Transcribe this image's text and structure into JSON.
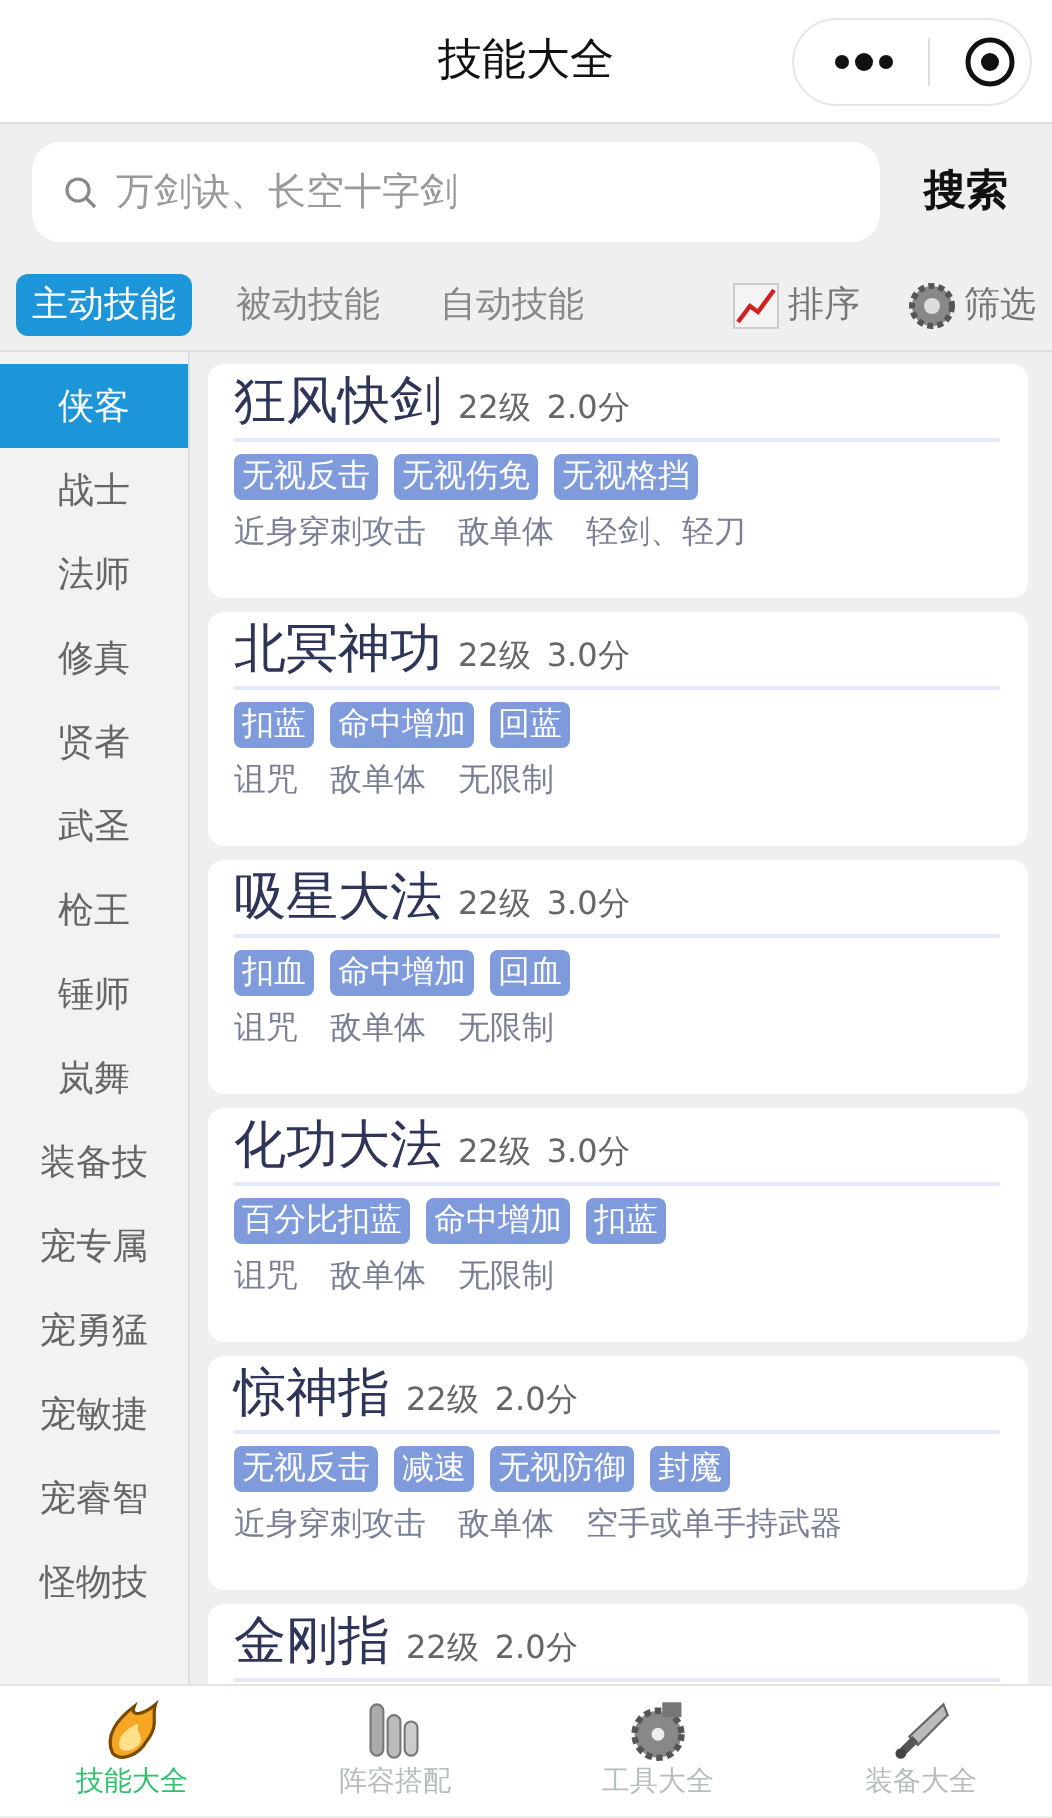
{
  "header": {
    "title": "技能大全"
  },
  "search": {
    "placeholder": "万剑诀、长空十字剑",
    "button": "搜索"
  },
  "tabs": [
    {
      "label": "主动技能",
      "selected": true
    },
    {
      "label": "被动技能",
      "selected": false
    },
    {
      "label": "自动技能",
      "selected": false
    }
  ],
  "tools": [
    {
      "label": "排序",
      "kind": "sort"
    },
    {
      "label": "筛选",
      "kind": "filter"
    }
  ],
  "sidebar": {
    "items": [
      {
        "label": "侠客",
        "selected": true
      },
      {
        "label": "战士",
        "selected": false
      },
      {
        "label": "法师",
        "selected": false
      },
      {
        "label": "修真",
        "selected": false
      },
      {
        "label": "贤者",
        "selected": false
      },
      {
        "label": "武圣",
        "selected": false
      },
      {
        "label": "枪王",
        "selected": false
      },
      {
        "label": "锤师",
        "selected": false
      },
      {
        "label": "岚舞",
        "selected": false
      },
      {
        "label": "装备技",
        "selected": false
      },
      {
        "label": "宠专属",
        "selected": false
      },
      {
        "label": "宠勇猛",
        "selected": false
      },
      {
        "label": "宠敏捷",
        "selected": false
      },
      {
        "label": "宠睿智",
        "selected": false
      },
      {
        "label": "怪物技",
        "selected": false
      }
    ]
  },
  "skills": [
    {
      "name": "狂风快剑",
      "level": "22级",
      "score": "2.0分",
      "tags": [
        "无视反击",
        "无视伤免",
        "无视格挡"
      ],
      "props": [
        "近身穿刺攻击",
        "敌单体",
        "轻剑、轻刀"
      ]
    },
    {
      "name": "北冥神功",
      "level": "22级",
      "score": "3.0分",
      "tags": [
        "扣蓝",
        "命中增加",
        "回蓝"
      ],
      "props": [
        "诅咒",
        "敌单体",
        "无限制"
      ]
    },
    {
      "name": "吸星大法",
      "level": "22级",
      "score": "3.0分",
      "tags": [
        "扣血",
        "命中增加",
        "回血"
      ],
      "props": [
        "诅咒",
        "敌单体",
        "无限制"
      ]
    },
    {
      "name": "化功大法",
      "level": "22级",
      "score": "3.0分",
      "tags": [
        "百分比扣蓝",
        "命中增加",
        "扣蓝"
      ],
      "props": [
        "诅咒",
        "敌单体",
        "无限制"
      ]
    },
    {
      "name": "惊神指",
      "level": "22级",
      "score": "2.0分",
      "tags": [
        "无视反击",
        "减速",
        "无视防御",
        "封魔"
      ],
      "props": [
        "近身穿刺攻击",
        "敌单体",
        "空手或单手持武器"
      ]
    },
    {
      "name": "金刚指",
      "level": "22级",
      "score": "2.0分"
    }
  ],
  "bottom_nav": [
    {
      "label": "技能大全",
      "selected": true,
      "kind": "flame"
    },
    {
      "label": "阵容搭配",
      "selected": false,
      "kind": "tubes"
    },
    {
      "label": "工具大全",
      "selected": false,
      "kind": "gear"
    },
    {
      "label": "装备大全",
      "selected": false,
      "kind": "sword"
    }
  ]
}
